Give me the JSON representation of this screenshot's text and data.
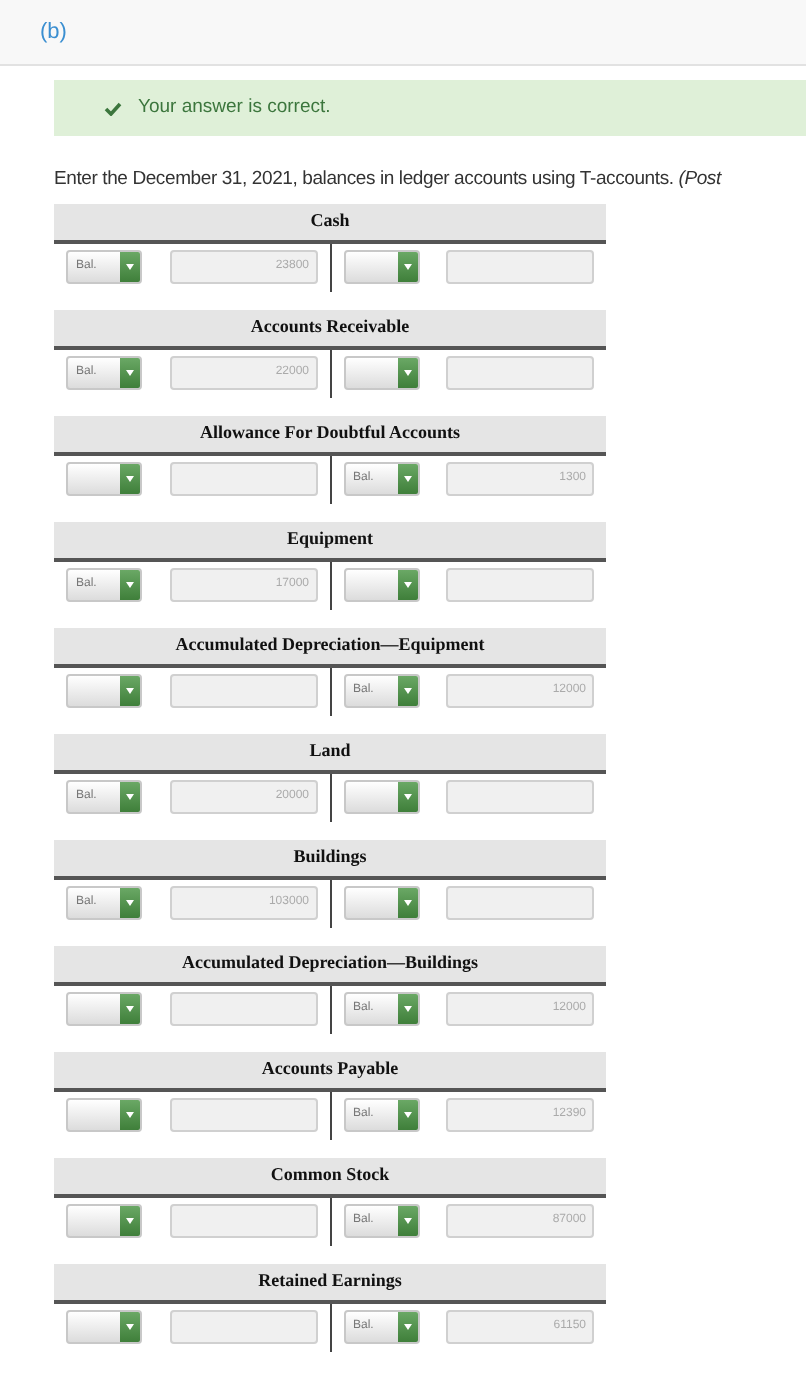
{
  "part_label": "(b)",
  "feedback": {
    "kind": "correct",
    "text": "Your answer is correct."
  },
  "instruction": "Enter the December 31, 2021, balances in ledger accounts using T-accounts. *(Post*",
  "accounts": [
    {
      "name": "Cash",
      "credit_balance": false,
      "select_label": "Bal.",
      "amount": "23800"
    },
    {
      "name": "Accounts Receivable",
      "credit_balance": false,
      "select_label": "Bal.",
      "amount": "22000"
    },
    {
      "name": "Allowance For Doubtful Accounts",
      "credit_balance": true,
      "select_label": "Bal.",
      "amount": "1300"
    },
    {
      "name": "Equipment",
      "credit_balance": false,
      "select_label": "Bal.",
      "amount": "17000"
    },
    {
      "name": "Accumulated Depreciation—Equipment",
      "credit_balance": true,
      "select_label": "Bal.",
      "amount": "12000"
    },
    {
      "name": "Land",
      "credit_balance": false,
      "select_label": "Bal.",
      "amount": "20000"
    },
    {
      "name": "Buildings",
      "credit_balance": false,
      "select_label": "Bal.",
      "amount": "103000"
    },
    {
      "name": "Accumulated Depreciation—Buildings",
      "credit_balance": true,
      "select_label": "Bal.",
      "amount": "12000"
    },
    {
      "name": "Accounts Payable",
      "credit_balance": true,
      "select_label": "Bal.",
      "amount": "12390"
    },
    {
      "name": "Common Stock",
      "credit_balance": true,
      "select_label": "Bal.",
      "amount": "87000"
    },
    {
      "name": "Retained Earnings",
      "credit_balance": true,
      "select_label": "Bal.",
      "amount": "61150"
    }
  ]
}
